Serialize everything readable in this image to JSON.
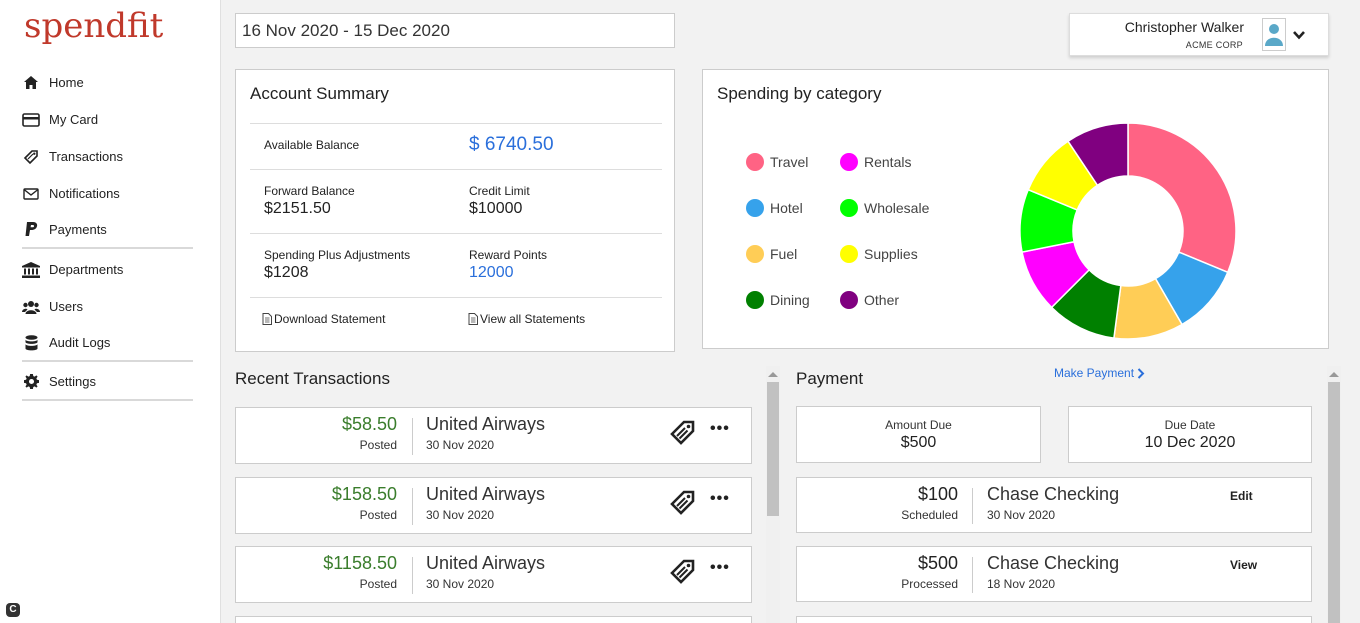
{
  "app": {
    "logo": "spendfit"
  },
  "sidebar": {
    "items": [
      {
        "label": "Home",
        "icon": "home-icon"
      },
      {
        "label": "My Card",
        "icon": "card-icon"
      },
      {
        "label": "Transactions",
        "icon": "tag-icon"
      },
      {
        "label": "Notifications",
        "icon": "envelope-icon"
      },
      {
        "label": "Payments",
        "icon": "paypal-icon"
      },
      {
        "label": "Departments",
        "icon": "bank-icon"
      },
      {
        "label": "Users",
        "icon": "users-icon"
      },
      {
        "label": "Audit Logs",
        "icon": "database-icon"
      },
      {
        "label": "Settings",
        "icon": "gear-icon"
      }
    ]
  },
  "header": {
    "date_range": "16 Nov 2020 - 15 Dec 2020",
    "user_name": "Christopher Walker",
    "user_org": "ACME CORP"
  },
  "account_summary": {
    "title": "Account Summary",
    "available_balance_label": "Available Balance",
    "available_balance": "$ 6740.50",
    "forward_balance_label": "Forward Balance",
    "forward_balance": "$2151.50",
    "credit_limit_label": "Credit Limit",
    "credit_limit": "$10000",
    "spending_plus_label": "Spending Plus Adjustments",
    "spending_plus": "$1208",
    "reward_points_label": "Reward Points",
    "reward_points": "12000",
    "download_statement": "Download Statement",
    "view_all_statements": "View all Statements"
  },
  "spending": {
    "title": "Spending by category",
    "categories": [
      {
        "name": "Travel",
        "color": "#ff6384",
        "share": 0.3
      },
      {
        "name": "Rentals",
        "color": "#ff00ff",
        "share": 0.09
      },
      {
        "name": "Hotel",
        "color": "#36a2eb",
        "share": 0.1
      },
      {
        "name": "Wholesale",
        "color": "#00ff00",
        "share": 0.09
      },
      {
        "name": "Fuel",
        "color": "#ffcd56",
        "share": 0.1
      },
      {
        "name": "Supplies",
        "color": "#ffff00",
        "share": 0.09
      },
      {
        "name": "Dining",
        "color": "#008000",
        "share": 0.1
      },
      {
        "name": "Other",
        "color": "#800080",
        "share": 0.09
      }
    ]
  },
  "recent_transactions": {
    "title": "Recent Transactions",
    "items": [
      {
        "amount": "$58.50",
        "status": "Posted",
        "merchant": "United Airways",
        "date": "30 Nov 2020"
      },
      {
        "amount": "$158.50",
        "status": "Posted",
        "merchant": "United Airways",
        "date": "30 Nov 2020"
      },
      {
        "amount": "$1158.50",
        "status": "Posted",
        "merchant": "United Airways",
        "date": "30 Nov 2020"
      }
    ],
    "more_label": "•••"
  },
  "payment": {
    "title": "Payment",
    "make_payment": "Make Payment",
    "amount_due_label": "Amount Due",
    "amount_due": "$500",
    "due_date_label": "Due Date",
    "due_date": "10 Dec 2020",
    "items": [
      {
        "amount": "$100",
        "status": "Scheduled",
        "name": "Chase Checking",
        "date": "30 Nov 2020",
        "action": "Edit"
      },
      {
        "amount": "$500",
        "status": "Processed",
        "name": "Chase Checking",
        "date": "18 Nov 2020",
        "action": "View"
      }
    ]
  },
  "footer_badge": "C"
}
